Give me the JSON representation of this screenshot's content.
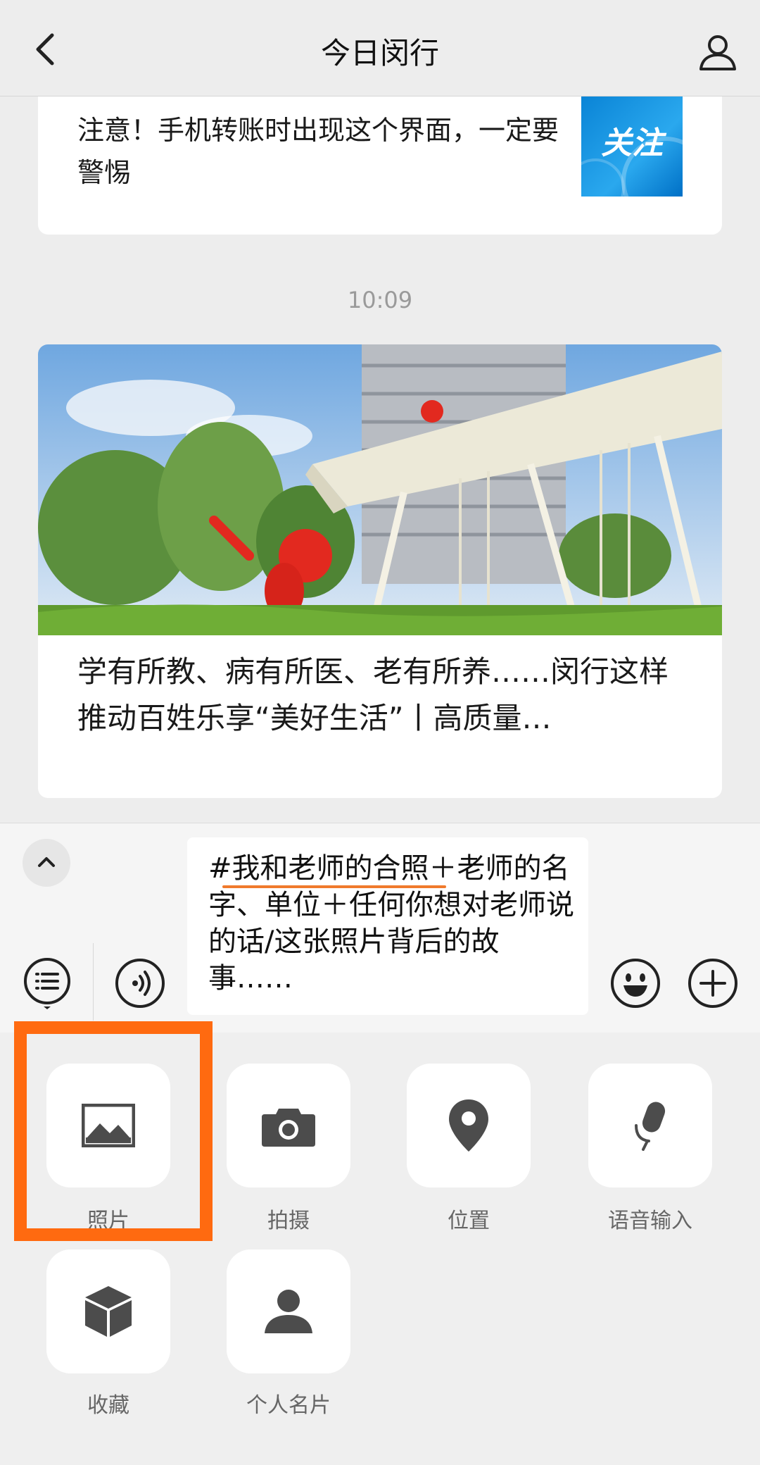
{
  "header": {
    "title": "今日闵行",
    "back_icon": "chevron-left-icon",
    "profile_icon": "person-icon"
  },
  "chat": {
    "article1": {
      "title": "注意！手机转账时出现这个界面，一定要警惕",
      "thumbnail_label": "关注"
    },
    "timestamp": "10:09",
    "article2": {
      "title": "学有所教、病有所医、老有所养……闵行这样推动百姓乐享“美好生活”丨高质量…"
    }
  },
  "input": {
    "draft_text": "#我和老师的合照＋老师的名字、单位＋任何你想对老师说的话/这张照片背后的故事……",
    "expand_icon": "chevron-up-icon",
    "menu_icon": "list-menu-icon",
    "voice_icon": "voice-icon",
    "emoji_icon": "emoji-icon",
    "plus_icon": "plus-icon"
  },
  "panel": {
    "items": [
      {
        "label": "照片",
        "icon": "photo-icon"
      },
      {
        "label": "拍摄",
        "icon": "camera-icon"
      },
      {
        "label": "位置",
        "icon": "location-icon"
      },
      {
        "label": "语音输入",
        "icon": "microphone-icon"
      },
      {
        "label": "收藏",
        "icon": "favorites-box-icon"
      },
      {
        "label": "个人名片",
        "icon": "contact-card-icon"
      }
    ]
  },
  "colors": {
    "highlight": "#ff6a10",
    "icon": "#4c4c4c",
    "underline": "#f07a2c"
  }
}
